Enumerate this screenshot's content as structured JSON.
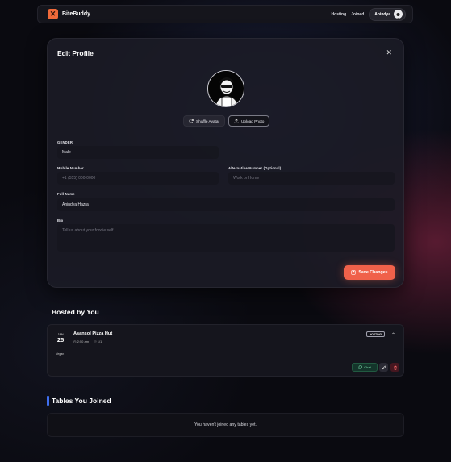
{
  "nav": {
    "brand": "BiteBuddy",
    "links": [
      "Hosting",
      "Joined"
    ],
    "user_name": "Anindya"
  },
  "modal": {
    "title": "Edit Profile",
    "shuffle_label": "Shuffle Avatar",
    "upload_label": "Upload Photo",
    "gender": {
      "label": "GENDER",
      "value": "Male"
    },
    "mobile": {
      "label": "Mobile Number",
      "placeholder": "+1 (555) 000-0000"
    },
    "alt": {
      "label": "Alternative Number (Optional)",
      "placeholder": "Work or Home"
    },
    "fullname": {
      "label": "Full Name",
      "value": "Anindya Hazra"
    },
    "bio": {
      "label": "Bio",
      "placeholder": "Tell us about your foodie self..."
    },
    "save_label": "Save Changes"
  },
  "hosted": {
    "title": "Hosted by You",
    "card": {
      "month": "JAN",
      "day": "25",
      "name": "Asansol Pizza Hut",
      "time": "2:50 am",
      "seats": "1/1",
      "badge": "HOSTING",
      "tag": "Vegan",
      "chat_label": "Chat"
    }
  },
  "joined": {
    "title": "Tables You Joined",
    "empty": "You haven't joined any tables yet."
  },
  "colors": {
    "accent": "#f0614a",
    "brand": "#f06a3a",
    "joined_accent": "#3f6ff0"
  }
}
